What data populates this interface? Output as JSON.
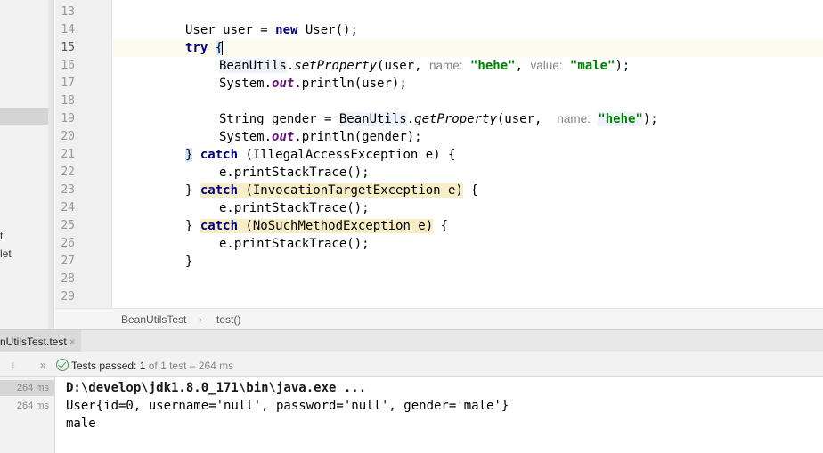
{
  "sidebar": {
    "fragment_1": "t",
    "fragment_2": "let"
  },
  "gutter": {
    "line_numbers": [
      "13",
      "14",
      "15",
      "16",
      "17",
      "18",
      "19",
      "20",
      "21",
      "22",
      "23",
      "24",
      "25",
      "26",
      "27",
      "28",
      "29"
    ]
  },
  "editor": {
    "l14_type": "User",
    "l14_var": " user = ",
    "l14_new": "new",
    "l14_rest": " User();",
    "l15_try": "try",
    "l15_brace": "{",
    "l16_cls": "BeanUtils",
    "l16_method": "setProperty",
    "l16_arg": "(user, ",
    "l16_hint1": "name:",
    "l16_str1": "\"hehe\"",
    "l16_comma": ", ",
    "l16_hint2": "value:",
    "l16_str2": "\"male\"",
    "l16_end": ");",
    "l17_sys": "System.",
    "l17_out": "out",
    "l17_rest": ".println(user);",
    "l19_pre": "String gender = ",
    "l19_cls": "BeanUtils",
    "l19_method": "getProperty",
    "l19_arg": "(user,  ",
    "l19_hint": "name:",
    "l19_str": "\"hehe\"",
    "l19_end": ");",
    "l20_sys": "System.",
    "l20_out": "out",
    "l20_rest": ".println(gender);",
    "l21_brace": "}",
    "l21_catch": "catch",
    "l21_rest": " (IllegalAccessException e) {",
    "l22": "e.printStackTrace();",
    "l23_brace": "} ",
    "l23_catch": "catch",
    "l23_warn": " (InvocationTargetException e)",
    "l23_rest": " {",
    "l24": "e.printStackTrace();",
    "l25_brace": "} ",
    "l25_catch": "catch",
    "l25_warn": " (NoSuchMethodException e)",
    "l25_rest": " {",
    "l26": "e.printStackTrace();",
    "l27": "}"
  },
  "breadcrumb": {
    "class_name": "BeanUtilsTest",
    "separator": "›",
    "method_name": "test()"
  },
  "run": {
    "tab_label": "nUtilsTest.test",
    "tab_close": "×",
    "status_label": "Tests passed:",
    "passed_count": "1",
    "status_rest": "of 1 test – 264 ms",
    "durations": [
      "264 ms",
      "264 ms"
    ],
    "console_lines": [
      "D:\\develop\\jdk1.8.0_171\\bin\\java.exe ...",
      "User{id=0, username='null', password='null', gender='male'}",
      "male"
    ]
  },
  "colors": {
    "keyword": "#000080",
    "string": "#008000",
    "pass": "#499c54",
    "static_field": "#660e7a"
  },
  "icons": [
    "check-circle-icon",
    "arrow-down-icon",
    "expand-icon",
    "close-icon"
  ]
}
